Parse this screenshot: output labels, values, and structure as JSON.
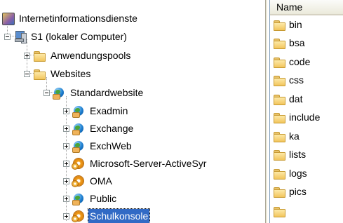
{
  "tree": {
    "root": {
      "label": "Internetinformationsdienste",
      "icon": "iis-icon"
    },
    "server": {
      "label": "S1 (lokaler Computer)",
      "icon": "computer-icon"
    },
    "app_pools": {
      "label": "Anwendungspools",
      "icon": "folder-icon"
    },
    "websites": {
      "label": "Websites",
      "icon": "folder-icon"
    },
    "default_site": {
      "label": "Standardwebsite",
      "icon": "globe-icon"
    },
    "children": [
      {
        "label": "Exadmin",
        "icon": "globe-icon"
      },
      {
        "label": "Exchange",
        "icon": "globe-icon"
      },
      {
        "label": "ExchWeb",
        "icon": "globe-icon"
      },
      {
        "label": "Microsoft-Server-ActiveSyr",
        "icon": "gear-icon"
      },
      {
        "label": "OMA",
        "icon": "gear-icon"
      },
      {
        "label": "Public",
        "icon": "globe-icon"
      },
      {
        "label": "Schulkonsole",
        "icon": "gear-icon",
        "selected": true
      }
    ]
  },
  "list": {
    "column_header": "Name",
    "items": [
      "bin",
      "bsa",
      "code",
      "css",
      "dat",
      "include",
      "ka",
      "lists",
      "logs",
      "pics"
    ]
  },
  "colors": {
    "selection": "#316ac5",
    "folder": "#f2c55c",
    "header_bg": "#ebeadb"
  }
}
